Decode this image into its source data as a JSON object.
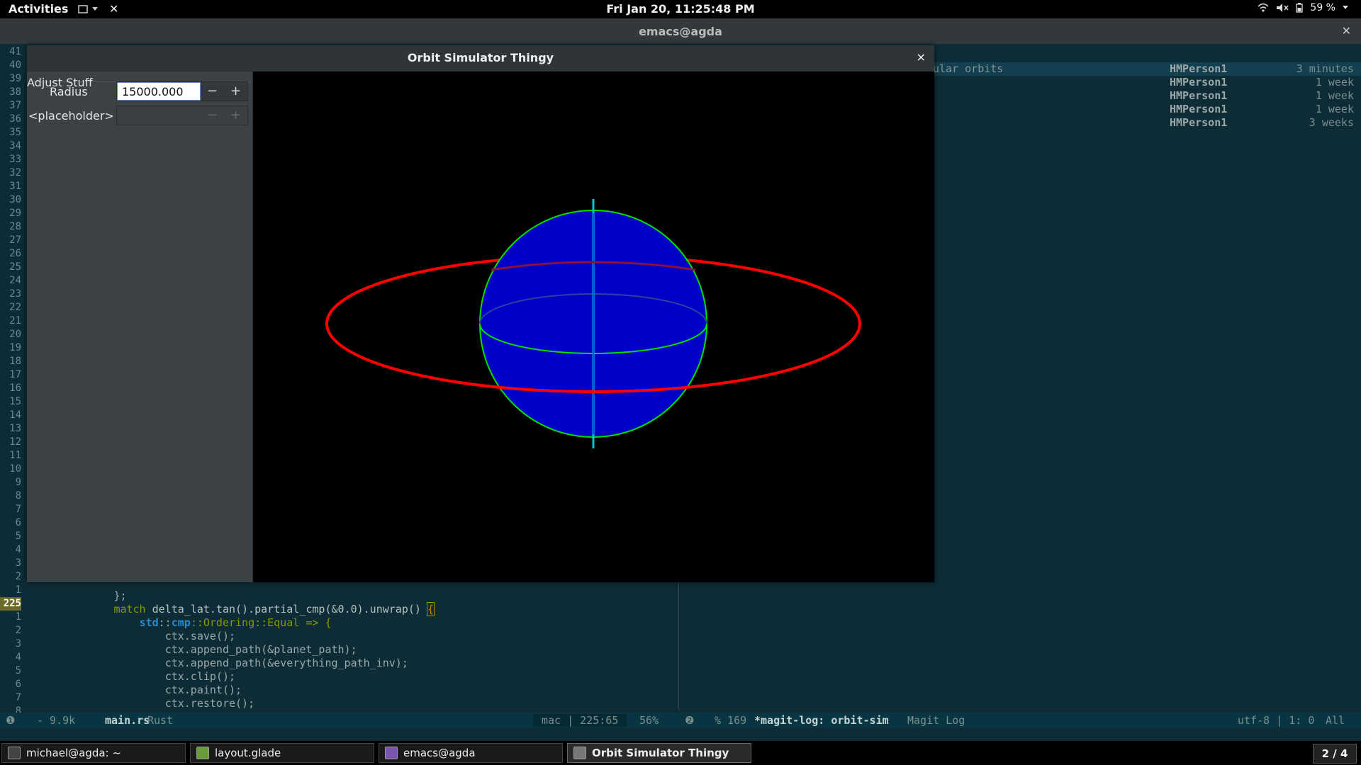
{
  "top_bar": {
    "activities": "Activities",
    "app_menu_close": "✕",
    "clock": "Fri Jan 20, 11:25:48 PM",
    "battery": "59 %"
  },
  "emacs": {
    "title": "emacs@agda",
    "close": "✕",
    "gutter": [
      "41",
      "40",
      "39",
      "38",
      "37",
      "36",
      "35",
      "34",
      "33",
      "32",
      "31",
      "30",
      "29",
      "28",
      "27",
      "26",
      "25",
      "24",
      "23",
      "22",
      "21",
      "20",
      "19",
      "18",
      "17",
      "16",
      "15",
      "14",
      "13",
      "12",
      "11",
      "10",
      "9",
      "8",
      "7",
      "6",
      "5",
      "4",
      "3",
      "2",
      "1",
      "225",
      "1",
      "2",
      "3",
      "4",
      "5",
      "6",
      "7",
      "8"
    ],
    "current_line": "225",
    "code": {
      "line1": "};",
      "line2_kw": "match",
      "line2_rest": " delta_lat.tan().partial_cmp(&0.0).unwrap() ",
      "line2_cursor": "{",
      "line3_a": "std",
      "line3_b": "::",
      "line3_c": "cmp",
      "line3_d": "::Ordering::Equal => {",
      "line4": "ctx.save();",
      "line5": "ctx.append_path(&planet_path);",
      "line6": "ctx.append_path(&everything_path_inv);",
      "line7": "ctx.clip();",
      "line8": "ctx.paint();",
      "line9": "ctx.restore();"
    },
    "magit": {
      "commits": [
        {
          "message": "ular orbits",
          "author": "HMPerson1",
          "date": "3 minutes"
        },
        {
          "message": "",
          "author": "HMPerson1",
          "date": "1 week"
        },
        {
          "message": "",
          "author": "HMPerson1",
          "date": "1 week"
        },
        {
          "message": "",
          "author": "HMPerson1",
          "date": "1 week"
        },
        {
          "message": "",
          "author": "HMPerson1",
          "date": "3 weeks"
        }
      ]
    },
    "modeline": {
      "left_indicator": "❶",
      "size": "- 9.9k",
      "buffer": "main.rs",
      "mode": "Rust",
      "platform": "mac | 225:65",
      "percent": "56%",
      "right_indicator": "❷",
      "magit_info": "% 169",
      "magit_buffer": "*magit-log: orbit-sim",
      "magit_mode": "Magit Log",
      "encoding": "utf-8 | 1: 0",
      "position": "All"
    }
  },
  "dialog": {
    "title": "Orbit Simulator Thingy",
    "close": "×",
    "frame_label": "Adjust Stuff",
    "radius_label": "Radius",
    "radius_value": "15000.000",
    "placeholder_label": "<placeholder>",
    "minus": "−",
    "plus": "+",
    "colors": {
      "planet": "#0000cc",
      "orbit": "#ff0000",
      "outline": "#00dd00",
      "axis": "#00d0d0"
    }
  },
  "taskbar": {
    "tasks": [
      {
        "label": "michael@agda: ~",
        "icon": "terminal-icon"
      },
      {
        "label": "layout.glade",
        "icon": "glade-icon"
      },
      {
        "label": "emacs@agda",
        "icon": "emacs-icon"
      },
      {
        "label": "Orbit Simulator Thingy",
        "icon": "window-icon"
      }
    ],
    "workspace": "2 / 4"
  }
}
